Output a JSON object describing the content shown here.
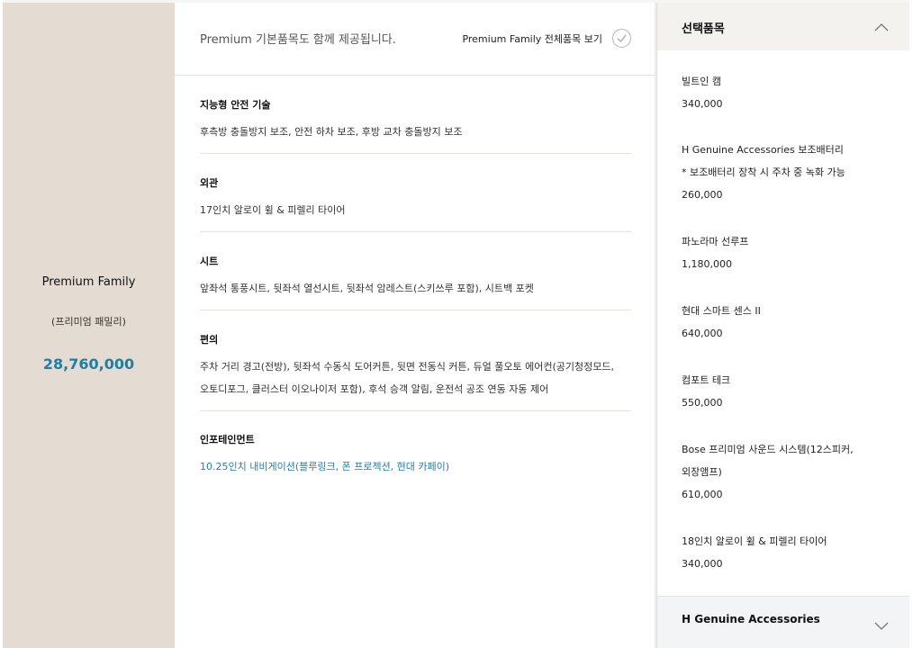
{
  "trim": {
    "name": "Premium Family",
    "sub": "(프리미엄 패밀리)",
    "price": "28,760,000"
  },
  "basic": {
    "notice": "Premium 기본품목도 함께 제공됩니다.",
    "view_all": "Premium Family 전체품목 보기",
    "specs": [
      {
        "category": "지능형 안전 기술",
        "lines": [
          "후측방 충돌방지 보조, 안전 하차 보조, 후방 교차 충돌방지 보조"
        ]
      },
      {
        "category": "외관",
        "lines": [
          "17인치 알로이 휠 & 피렐리 타이어"
        ]
      },
      {
        "category": "시트",
        "lines": [
          "앞좌석 통풍시트, 뒷좌석 열선시트, 뒷좌석 암레스트(스키쓰루 포함), 시트백 포켓"
        ]
      },
      {
        "category": "편의",
        "lines": [
          "주차 거리 경고(전방), 뒷좌석 수동식 도어커튼, 뒷면 전동식 커튼, 듀얼 풀오토 에어컨(공기청정모드,",
          "오토디포그, 클러스터 이오나이저 포함), 후석 승객 알림, 운전석 공조 연동 자동 제어"
        ]
      },
      {
        "category": "인포테인먼트",
        "lines": [
          "10.25인치 내비게이션(블루링크, 폰 프로젝션, 현대 카페이)"
        ]
      }
    ]
  },
  "selected": {
    "title": "선택품목",
    "options": [
      {
        "lines": [
          "빌트인 캠",
          "340,000"
        ]
      },
      {
        "lines": [
          "H Genuine Accessories 보조배터리",
          "* 보조배터리 장착 시 주차 중 녹화 가능",
          "260,000"
        ]
      },
      {
        "lines": [
          "파노라마 선루프",
          "1,180,000"
        ]
      },
      {
        "lines": [
          "현대 스마트 센스 II",
          "640,000"
        ]
      },
      {
        "lines": [
          "컴포트 테크",
          "550,000"
        ]
      },
      {
        "lines": [
          "Bose 프리미엄 사운드 시스템(12스피커,",
          "외장앰프)",
          "610,000"
        ]
      },
      {
        "lines": [
          "18인치 알로이 휠 & 피렐리 타이어",
          "340,000"
        ]
      }
    ],
    "accessories_title": "H Genuine Accessories"
  },
  "colors": {
    "trim_bg": "#e4dcd2",
    "price": "#1f7ea5",
    "link_blue": "#2a7da6"
  },
  "icons": {
    "check": "check-circle-icon",
    "collapse": "chevron-up-icon",
    "expand": "chevron-down-icon"
  }
}
